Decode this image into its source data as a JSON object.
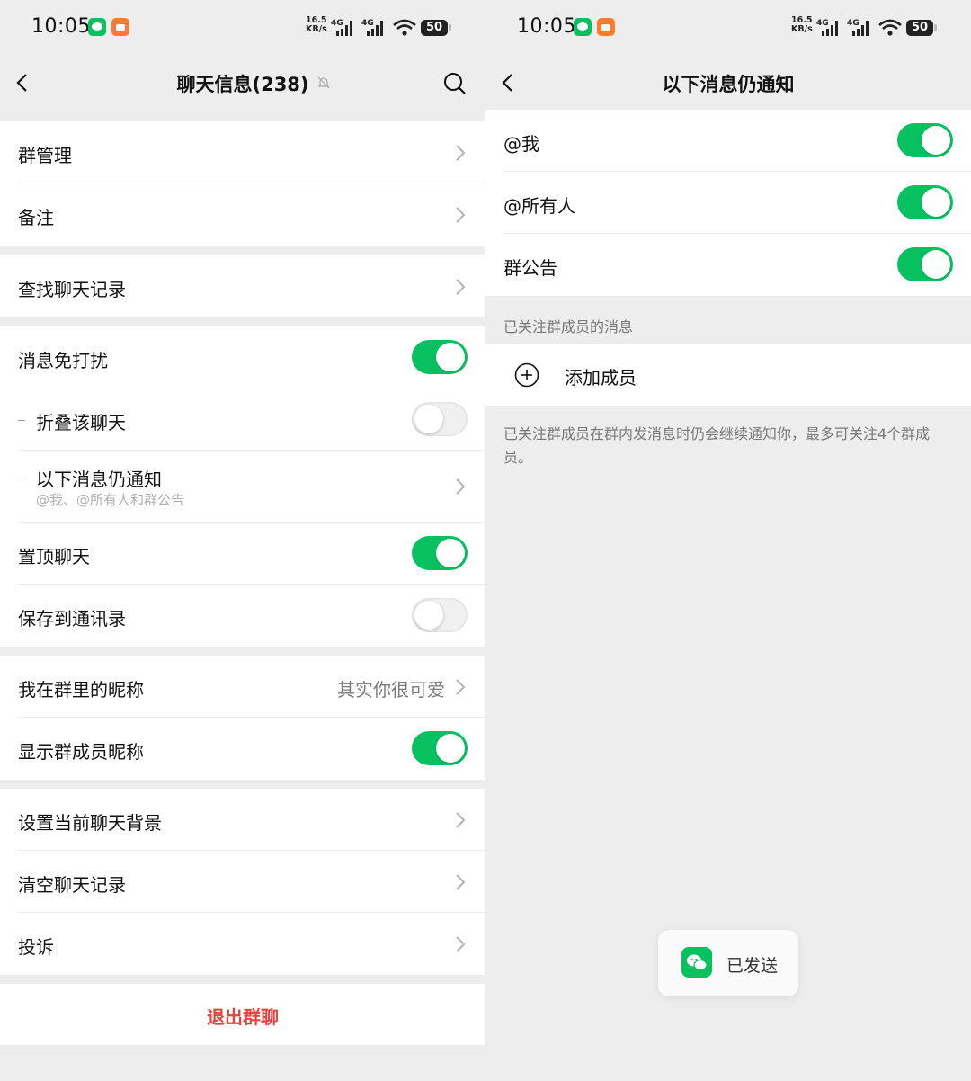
{
  "status_bar": {
    "time": "10:05",
    "speed_top": "16.5",
    "speed_bottom": "KB/s",
    "net1": "4G",
    "net2": "4G",
    "battery": "50"
  },
  "left": {
    "nav": {
      "title": "聊天信息(238)"
    },
    "groups": [
      {
        "rows": [
          {
            "label": "群管理"
          },
          {
            "label": "备注"
          }
        ]
      },
      {
        "rows": [
          {
            "label": "查找聊天记录"
          }
        ]
      },
      {
        "rows": [
          {
            "label": "消息免打扰",
            "toggle": true
          },
          {
            "label": "折叠该聊天",
            "toggle": false
          },
          {
            "label": "以下消息仍通知",
            "sublabel": "@我、@所有人和群公告"
          },
          {
            "label": "置顶聊天",
            "toggle": true
          },
          {
            "label": "保存到通讯录",
            "toggle": false
          }
        ]
      },
      {
        "rows": [
          {
            "label": "我在群里的昵称",
            "value": "其实你很可爱"
          },
          {
            "label": "显示群成员昵称",
            "toggle": true
          }
        ]
      },
      {
        "rows": [
          {
            "label": "设置当前聊天背景"
          },
          {
            "label": "清空聊天记录"
          },
          {
            "label": "投诉"
          }
        ]
      }
    ],
    "exit_label": "退出群聊"
  },
  "right": {
    "nav": {
      "title": "以下消息仍通知"
    },
    "rows": [
      {
        "label": "@我",
        "toggle": true
      },
      {
        "label": "@所有人",
        "toggle": true
      },
      {
        "label": "群公告",
        "toggle": true
      }
    ],
    "section_caption": "已关注群成员的消息",
    "add_member_label": "添加成员",
    "note": "已关注群成员在群内发消息时仍会继续通知你，最多可关注4个群成员。",
    "toast": "已发送"
  },
  "colors": {
    "accent": "#07c160",
    "danger": "#e64340",
    "background": "#ededed"
  }
}
